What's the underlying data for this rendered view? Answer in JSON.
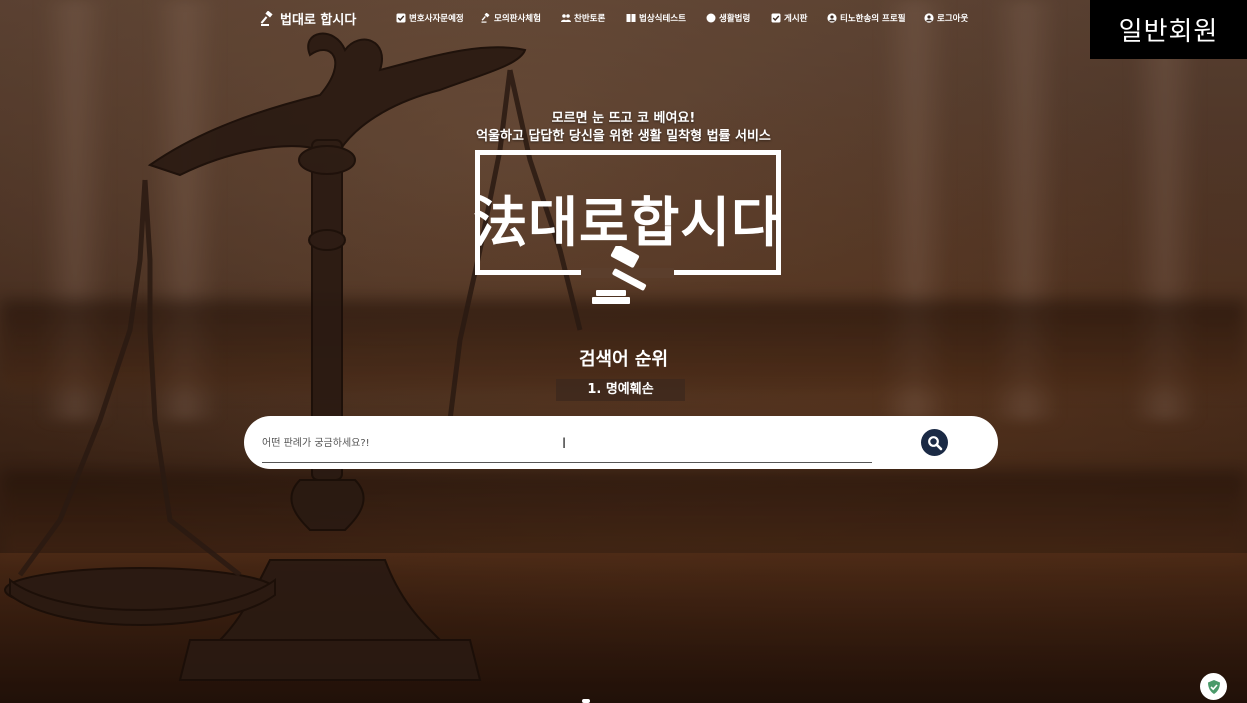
{
  "nav": {
    "logo": "법대로 합시다",
    "items": [
      {
        "icon": "check-square-icon",
        "label": "변호사자문예정"
      },
      {
        "icon": "gavel-icon",
        "label": "모의판사체험"
      },
      {
        "icon": "people-icon",
        "label": "찬반토론"
      },
      {
        "icon": "book-icon",
        "label": "법상식테스트"
      },
      {
        "icon": "circle-icon",
        "label": "생활법령"
      },
      {
        "icon": "check-square-icon",
        "label": "게시판"
      },
      {
        "icon": "user-icon",
        "label": "티노한송의 프로필"
      },
      {
        "icon": "user-icon",
        "label": "로그아웃"
      }
    ]
  },
  "member_badge": "일반회원",
  "hero": {
    "tagline1": "모르면 눈 뜨고 코 베여요!",
    "tagline2": "억울하고 답답한 당신을 위한 생활 밀착형 법률 서비스",
    "brand": "法대로합시다"
  },
  "ranking": {
    "title": "검색어 순위",
    "item": "1. 명예훼손"
  },
  "search": {
    "placeholder": "어떤 판례가 궁금하세요?!"
  },
  "colors": {
    "search_button": "#1b2a45",
    "badge_bg": "#000000"
  }
}
